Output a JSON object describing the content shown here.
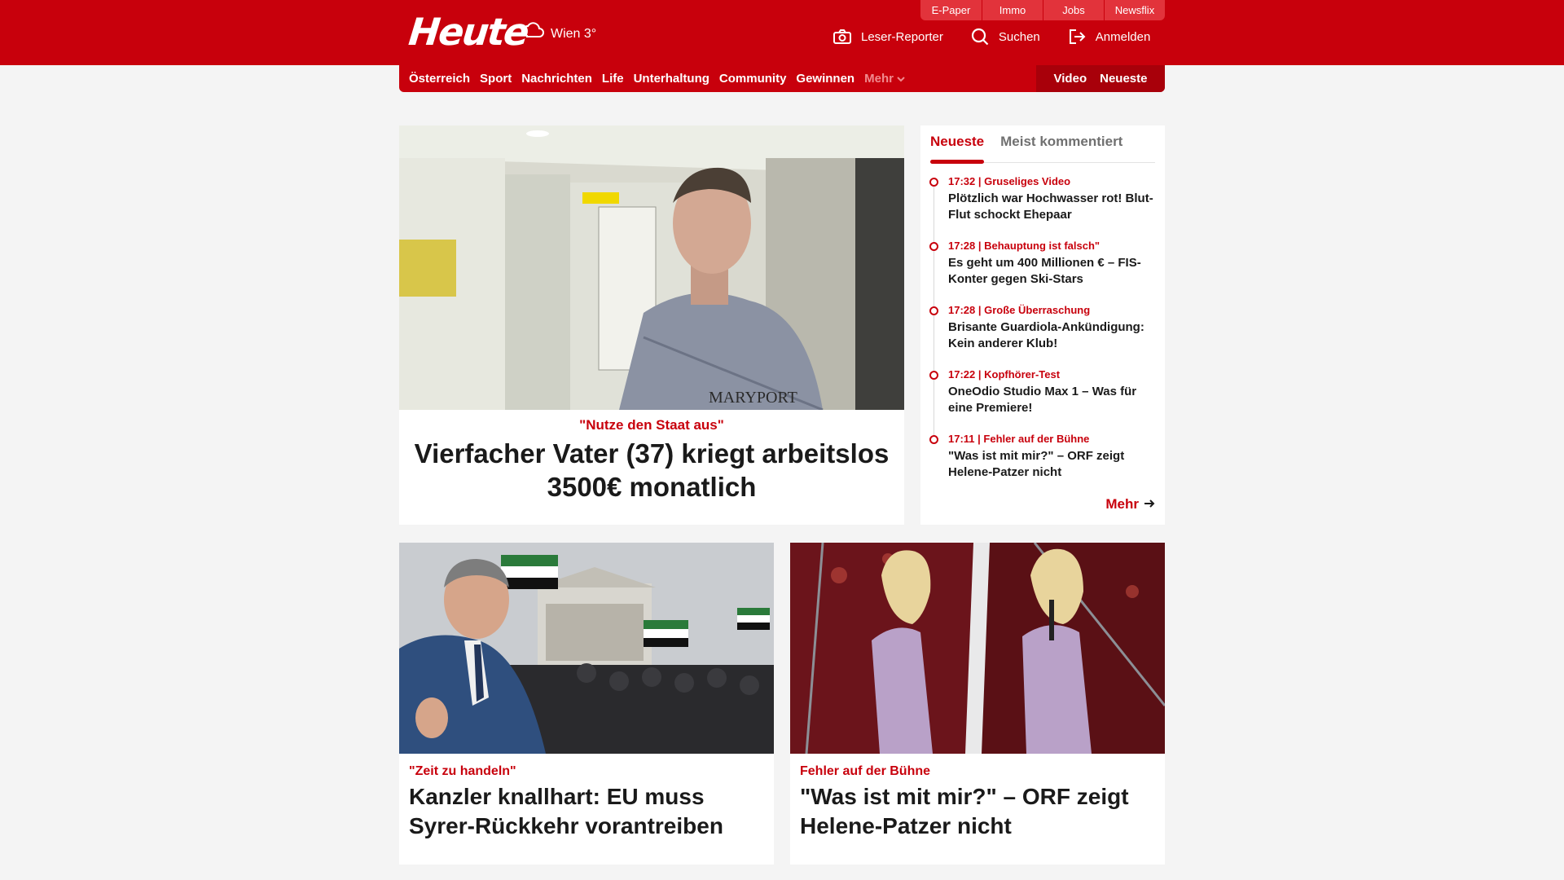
{
  "header": {
    "logo": "Heute",
    "weather": {
      "city_temp": "Wien 3°",
      "icon": "cloud-sun-icon"
    },
    "top_links": [
      "E-Paper",
      "Immo",
      "Jobs",
      "Newsflix"
    ],
    "actions": {
      "reporter": "Leser-Reporter",
      "search": "Suchen",
      "login": "Anmelden"
    },
    "colors": {
      "brand": "#c8000c"
    }
  },
  "nav": {
    "items": [
      "Österreich",
      "Sport",
      "Nachrichten",
      "Life",
      "Unterhaltung",
      "Community",
      "Gewinnen"
    ],
    "more": "Mehr",
    "video": "Video",
    "newest": "Neueste"
  },
  "hero": {
    "kicker": "\"Nutze den Staat aus\"",
    "title": "Vierfacher Vater (37) kriegt arbeitslos 3500€ monatlich"
  },
  "sidebar": {
    "tabs": [
      "Neueste",
      "Meist kommentiert"
    ],
    "items": [
      {
        "meta": "17:32 | Gruseliges Video",
        "title": "Plötzlich war Hochwasser rot! Blut-Flut schockt Ehepaar"
      },
      {
        "meta": "17:28 | Behauptung ist falsch\"",
        "title": "Es geht um 400 Millionen € – FIS-Konter gegen Ski-Stars"
      },
      {
        "meta": "17:28 | Große Überraschung",
        "title": "Brisante Guardiola-Ankündigung: Kein anderer Klub!"
      },
      {
        "meta": "17:22 | Kopfhörer-Test",
        "title": "OneOdio Studio Max 1 – Was für eine Premiere!"
      },
      {
        "meta": "17:11 | Fehler auf der Bühne",
        "title": "\"Was ist mit mir?\" – ORF zeigt Helene-Patzer nicht"
      }
    ],
    "more": "Mehr"
  },
  "cards": [
    {
      "kicker": "\"Zeit zu handeln\"",
      "title": "Kanzler knallhart: EU muss Syrer-Rückkehr vorantreiben"
    },
    {
      "kicker": "Fehler auf der Bühne",
      "title": "\"Was ist mit mir?\" – ORF zeigt Helene-Patzer nicht"
    }
  ]
}
